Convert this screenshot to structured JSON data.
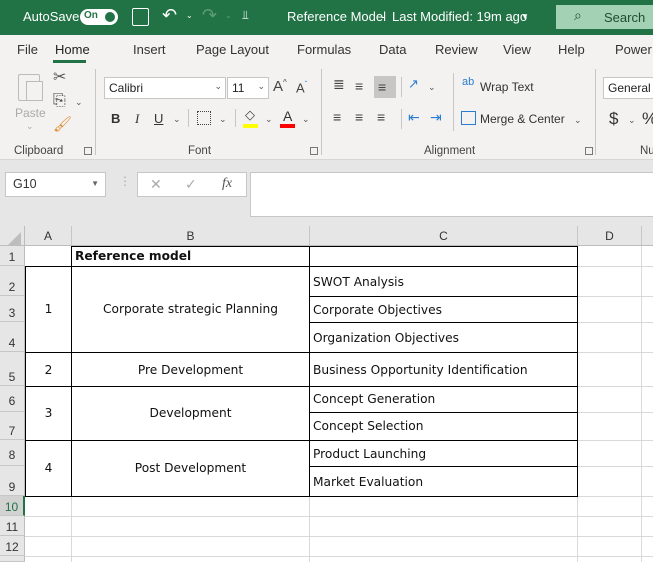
{
  "titlebar": {
    "autosave_label": "AutoSave",
    "autosave_state": "On",
    "document_title": "Reference Model",
    "separator": "-",
    "last_modified": "Last Modified: 19m ago",
    "search_label": "Search",
    "icons": {
      "save": "save-icon",
      "undo": "undo-icon",
      "redo": "redo-icon",
      "customize": "customize-qat-icon",
      "search": "search-icon"
    }
  },
  "tabs": [
    {
      "label": "File"
    },
    {
      "label": "Home",
      "active": true
    },
    {
      "label": "Insert"
    },
    {
      "label": "Page Layout"
    },
    {
      "label": "Formulas"
    },
    {
      "label": "Data"
    },
    {
      "label": "Review"
    },
    {
      "label": "View"
    },
    {
      "label": "Help"
    },
    {
      "label": "Power"
    }
  ],
  "ribbon": {
    "clipboard": {
      "label": "Clipboard",
      "paste_label": "Paste"
    },
    "font": {
      "label": "Font",
      "font_name": "Calibri",
      "font_size": "11",
      "bold": "B",
      "italic": "I",
      "underline": "U",
      "highlight_color": "#ffff00",
      "font_color": "#ff0000"
    },
    "alignment": {
      "label": "Alignment",
      "wrap_text": "Wrap Text",
      "merge_center": "Merge & Center"
    },
    "number": {
      "label": "Nu",
      "format": "General",
      "currency": "$",
      "percent": "%"
    }
  },
  "formula_bar": {
    "name_box": "G10",
    "fx_label": "fx",
    "formula_value": ""
  },
  "sheet": {
    "columns": [
      "A",
      "B",
      "C",
      "D"
    ],
    "rows": [
      "1",
      "2",
      "3",
      "4",
      "5",
      "6",
      "7",
      "8",
      "9",
      "10",
      "11",
      "12"
    ],
    "selected_row": "10",
    "title_cell": "Reference model",
    "stages": [
      {
        "number": "1",
        "name": "Corporate strategic Planning",
        "activities": [
          "SWOT Analysis",
          "Corporate Objectives",
          "Organization Objectives"
        ]
      },
      {
        "number": "2",
        "name": "Pre Development",
        "activities": [
          "Business Opportunity Identification"
        ]
      },
      {
        "number": "3",
        "name": "Development",
        "activities": [
          "Concept Generation",
          "Concept Selection"
        ]
      },
      {
        "number": "4",
        "name": "Post Development",
        "activities": [
          "Product Launching",
          "Market Evaluation"
        ]
      }
    ]
  },
  "colors": {
    "brand_green": "#217346",
    "search_bg": "#a3d1b4"
  }
}
